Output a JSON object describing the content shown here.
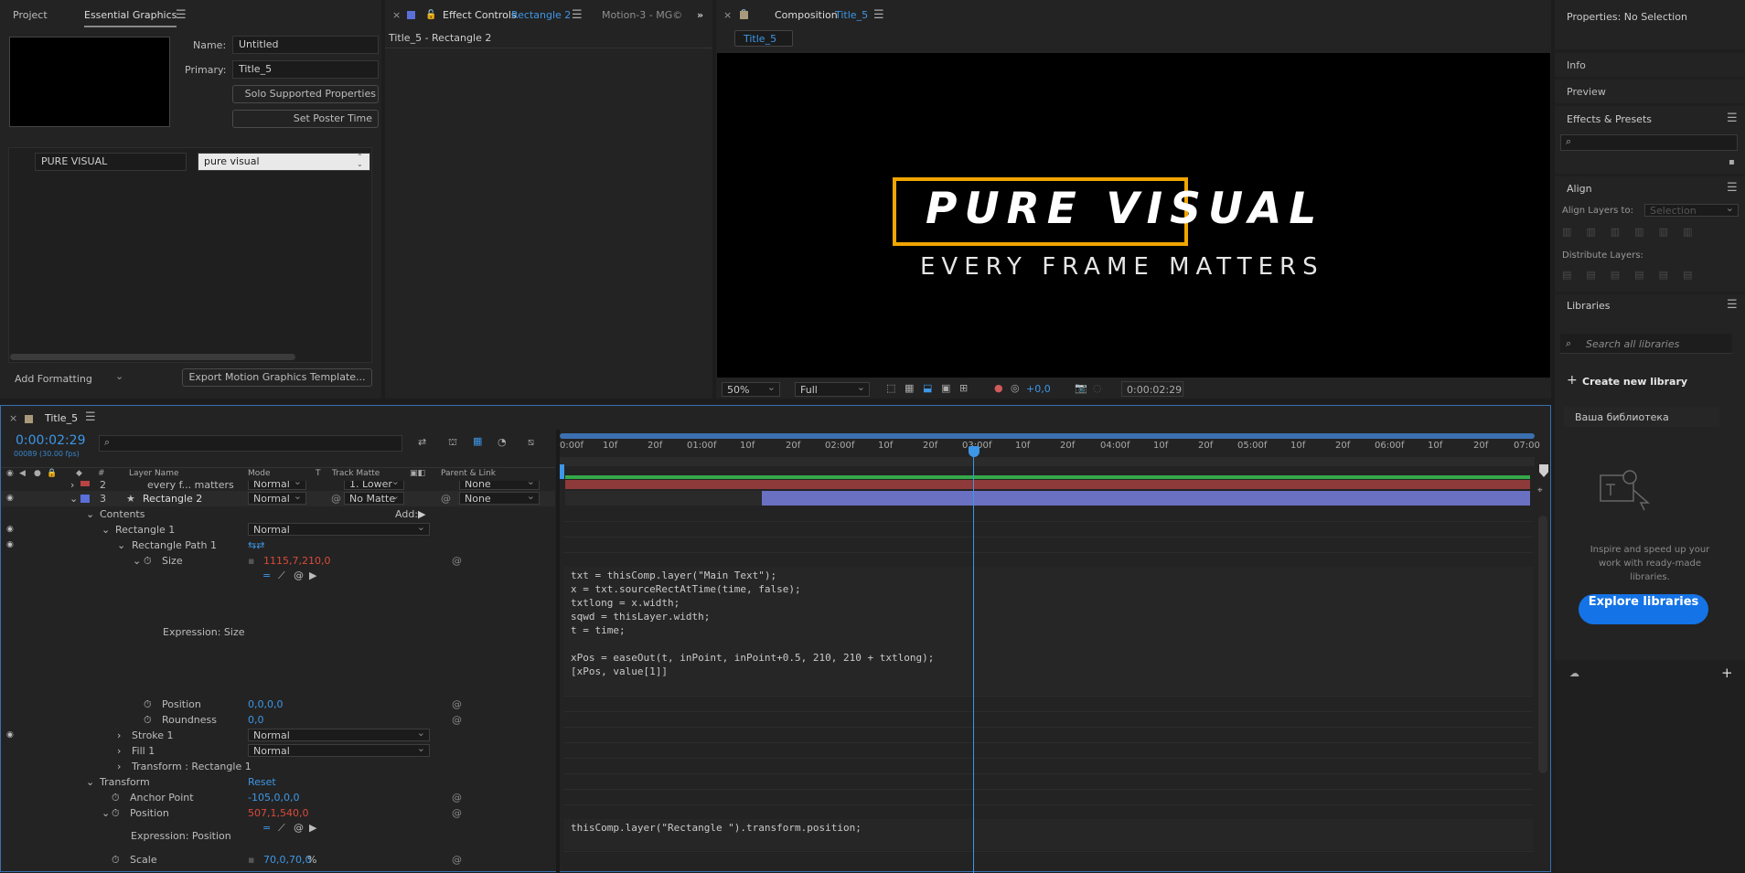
{
  "essential_graphics": {
    "tab_project": "Project",
    "tab_eg": "Essential Graphics",
    "name_label": "Name:",
    "name_value": "Untitled",
    "primary_label": "Primary:",
    "primary_value": "Title_5",
    "solo_button": "Solo Supported Properties",
    "poster_button": "Set Poster Time",
    "prop_name": "PURE VISUAL",
    "prop_value": "pure visual",
    "add_formatting": "Add Formatting",
    "export_button": "Export Motion Graphics Template..."
  },
  "effect_controls": {
    "tab_label": "Effect Controls",
    "tab_layer": "Rectangle 2",
    "tab_other": "Motion-3 - MG©",
    "subtitle": "Title_5 - Rectangle 2"
  },
  "composition": {
    "tab_label": "Composition",
    "tab_comp": "Title_5",
    "breadcrumb": "Title_5",
    "headline": "PURE VISUAL",
    "subline": "EVERY FRAME MATTERS",
    "accent": "#f0a500",
    "zoom": "50%",
    "resolution": "Full",
    "exposure": "+0,0",
    "timecode": "0:00:02:29"
  },
  "right_panel": {
    "properties": "Properties: No Selection",
    "info": "Info",
    "preview": "Preview",
    "effects_presets": "Effects & Presets",
    "align": "Align",
    "align_layers_to": "Align Layers to:",
    "align_target": "Selection",
    "distribute": "Distribute Layers:",
    "libraries": "Libraries",
    "search_placeholder": "Search all libraries",
    "create_library": "Create new library",
    "library_item": "Ваша библиотека",
    "promo_text": "Inspire and speed up your work with ready-made libraries.",
    "explore_button": "Explore libraries"
  },
  "timeline": {
    "tab": "Title_5",
    "timecode": "0:00:02:29",
    "frames": "00089 (30.00 fps)",
    "col_num": "#",
    "col_layer": "Layer Name",
    "col_mode": "Mode",
    "col_t": "T",
    "col_matte": "Track Matte",
    "col_parent": "Parent & Link",
    "ruler": [
      "0:00f",
      "10f",
      "20f",
      "01:00f",
      "10f",
      "20f",
      "02:00f",
      "10f",
      "20f",
      "03:00f",
      "10f",
      "20f",
      "04:00f",
      "10f",
      "20f",
      "05:00f",
      "10f",
      "20f",
      "06:00f",
      "10f",
      "20f",
      "07:00"
    ],
    "layer2_num": "2",
    "layer2_name": "every f... matters",
    "layer2_mode": "Normal",
    "layer2_matte": "1. Lower",
    "layer2_parent": "None",
    "layer3_num": "3",
    "layer3_name": "Rectangle 2",
    "layer3_mode": "Normal",
    "layer3_matte": "No Matte",
    "layer3_parent": "None",
    "contents": "Contents",
    "add": "Add:",
    "rect1": "Rectangle 1",
    "rect1_mode": "Normal",
    "rect_path": "Rectangle Path 1",
    "size": "Size",
    "size_value": "1115,7,210,0",
    "expr_size": "Expression: Size",
    "code_size": "txt = thisComp.layer(\"Main Text\");\nx = txt.sourceRectAtTime(time, false);\ntxtlong = x.width;\nsqwd = thisLayer.width;\nt = time;\n\nxPos = easeOut(t, inPoint, inPoint+0.5, 210, 210 + txtlong);\n[xPos, value[1]]",
    "position": "Position",
    "position_value": "0,0,0,0",
    "roundness": "Roundness",
    "roundness_value": "0,0",
    "stroke": "Stroke 1",
    "stroke_mode": "Normal",
    "fill": "Fill 1",
    "fill_mode": "Normal",
    "transform_rect": "Transform : Rectangle 1",
    "transform": "Transform",
    "reset": "Reset",
    "anchor": "Anchor Point",
    "anchor_value": "-105,0,0,0",
    "position2": "Position",
    "position2_value": "507,1,540,0",
    "expr_position": "Expression: Position",
    "code_position": "thisComp.layer(\"Rectangle \").transform.position;",
    "scale": "Scale",
    "scale_value": "70,0,70,0",
    "scale_unit": "%"
  }
}
